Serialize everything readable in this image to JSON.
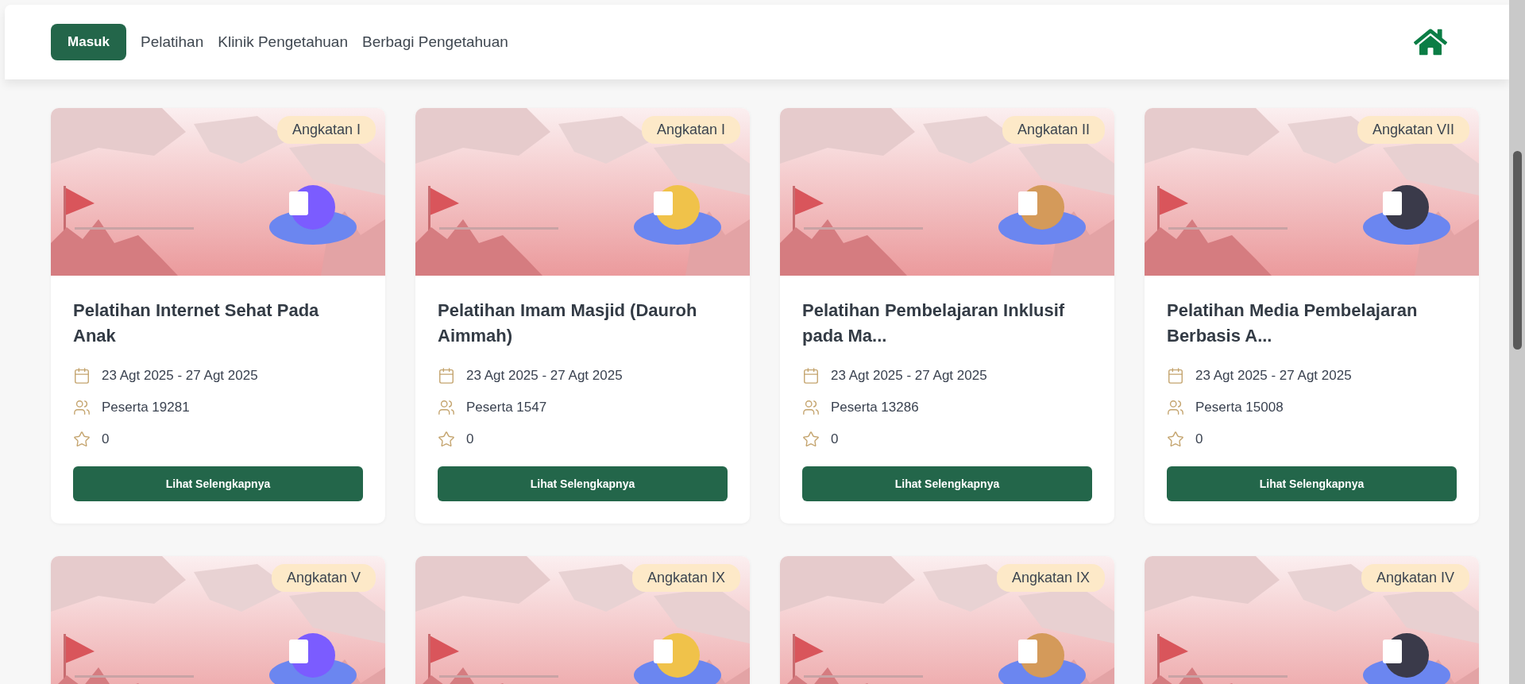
{
  "navbar": {
    "login_button": "Masuk",
    "links": [
      "Pelatihan",
      "Klinik Pengetahuan",
      "Berbagi Pengetahuan"
    ]
  },
  "courses": [
    {
      "batch": "Angkatan I",
      "title": "Pelatihan Internet Sehat Pada Anak",
      "date": "23 Agt 2025 - 27 Agt 2025",
      "participants": "Peserta 19281",
      "rating": "0",
      "button": "Lihat Selengkapnya"
    },
    {
      "batch": "Angkatan I",
      "title": "Pelatihan Imam Masjid (Dauroh Aimmah)",
      "date": "23 Agt 2025 - 27 Agt 2025",
      "participants": "Peserta 1547",
      "rating": "0",
      "button": "Lihat Selengkapnya"
    },
    {
      "batch": "Angkatan II",
      "title": "Pelatihan Pembelajaran Inklusif pada Ma...",
      "date": "23 Agt 2025 - 27 Agt 2025",
      "participants": "Peserta 13286",
      "rating": "0",
      "button": "Lihat Selengkapnya"
    },
    {
      "batch": "Angkatan VII",
      "title": "Pelatihan Media Pembelajaran Berbasis A...",
      "date": "23 Agt 2025 - 27 Agt 2025",
      "participants": "Peserta 15008",
      "rating": "0",
      "button": "Lihat Selengkapnya"
    },
    {
      "batch": "Angkatan V"
    },
    {
      "batch": "Angkatan IX"
    },
    {
      "batch": "Angkatan IX"
    },
    {
      "batch": "Angkatan IV"
    }
  ]
}
